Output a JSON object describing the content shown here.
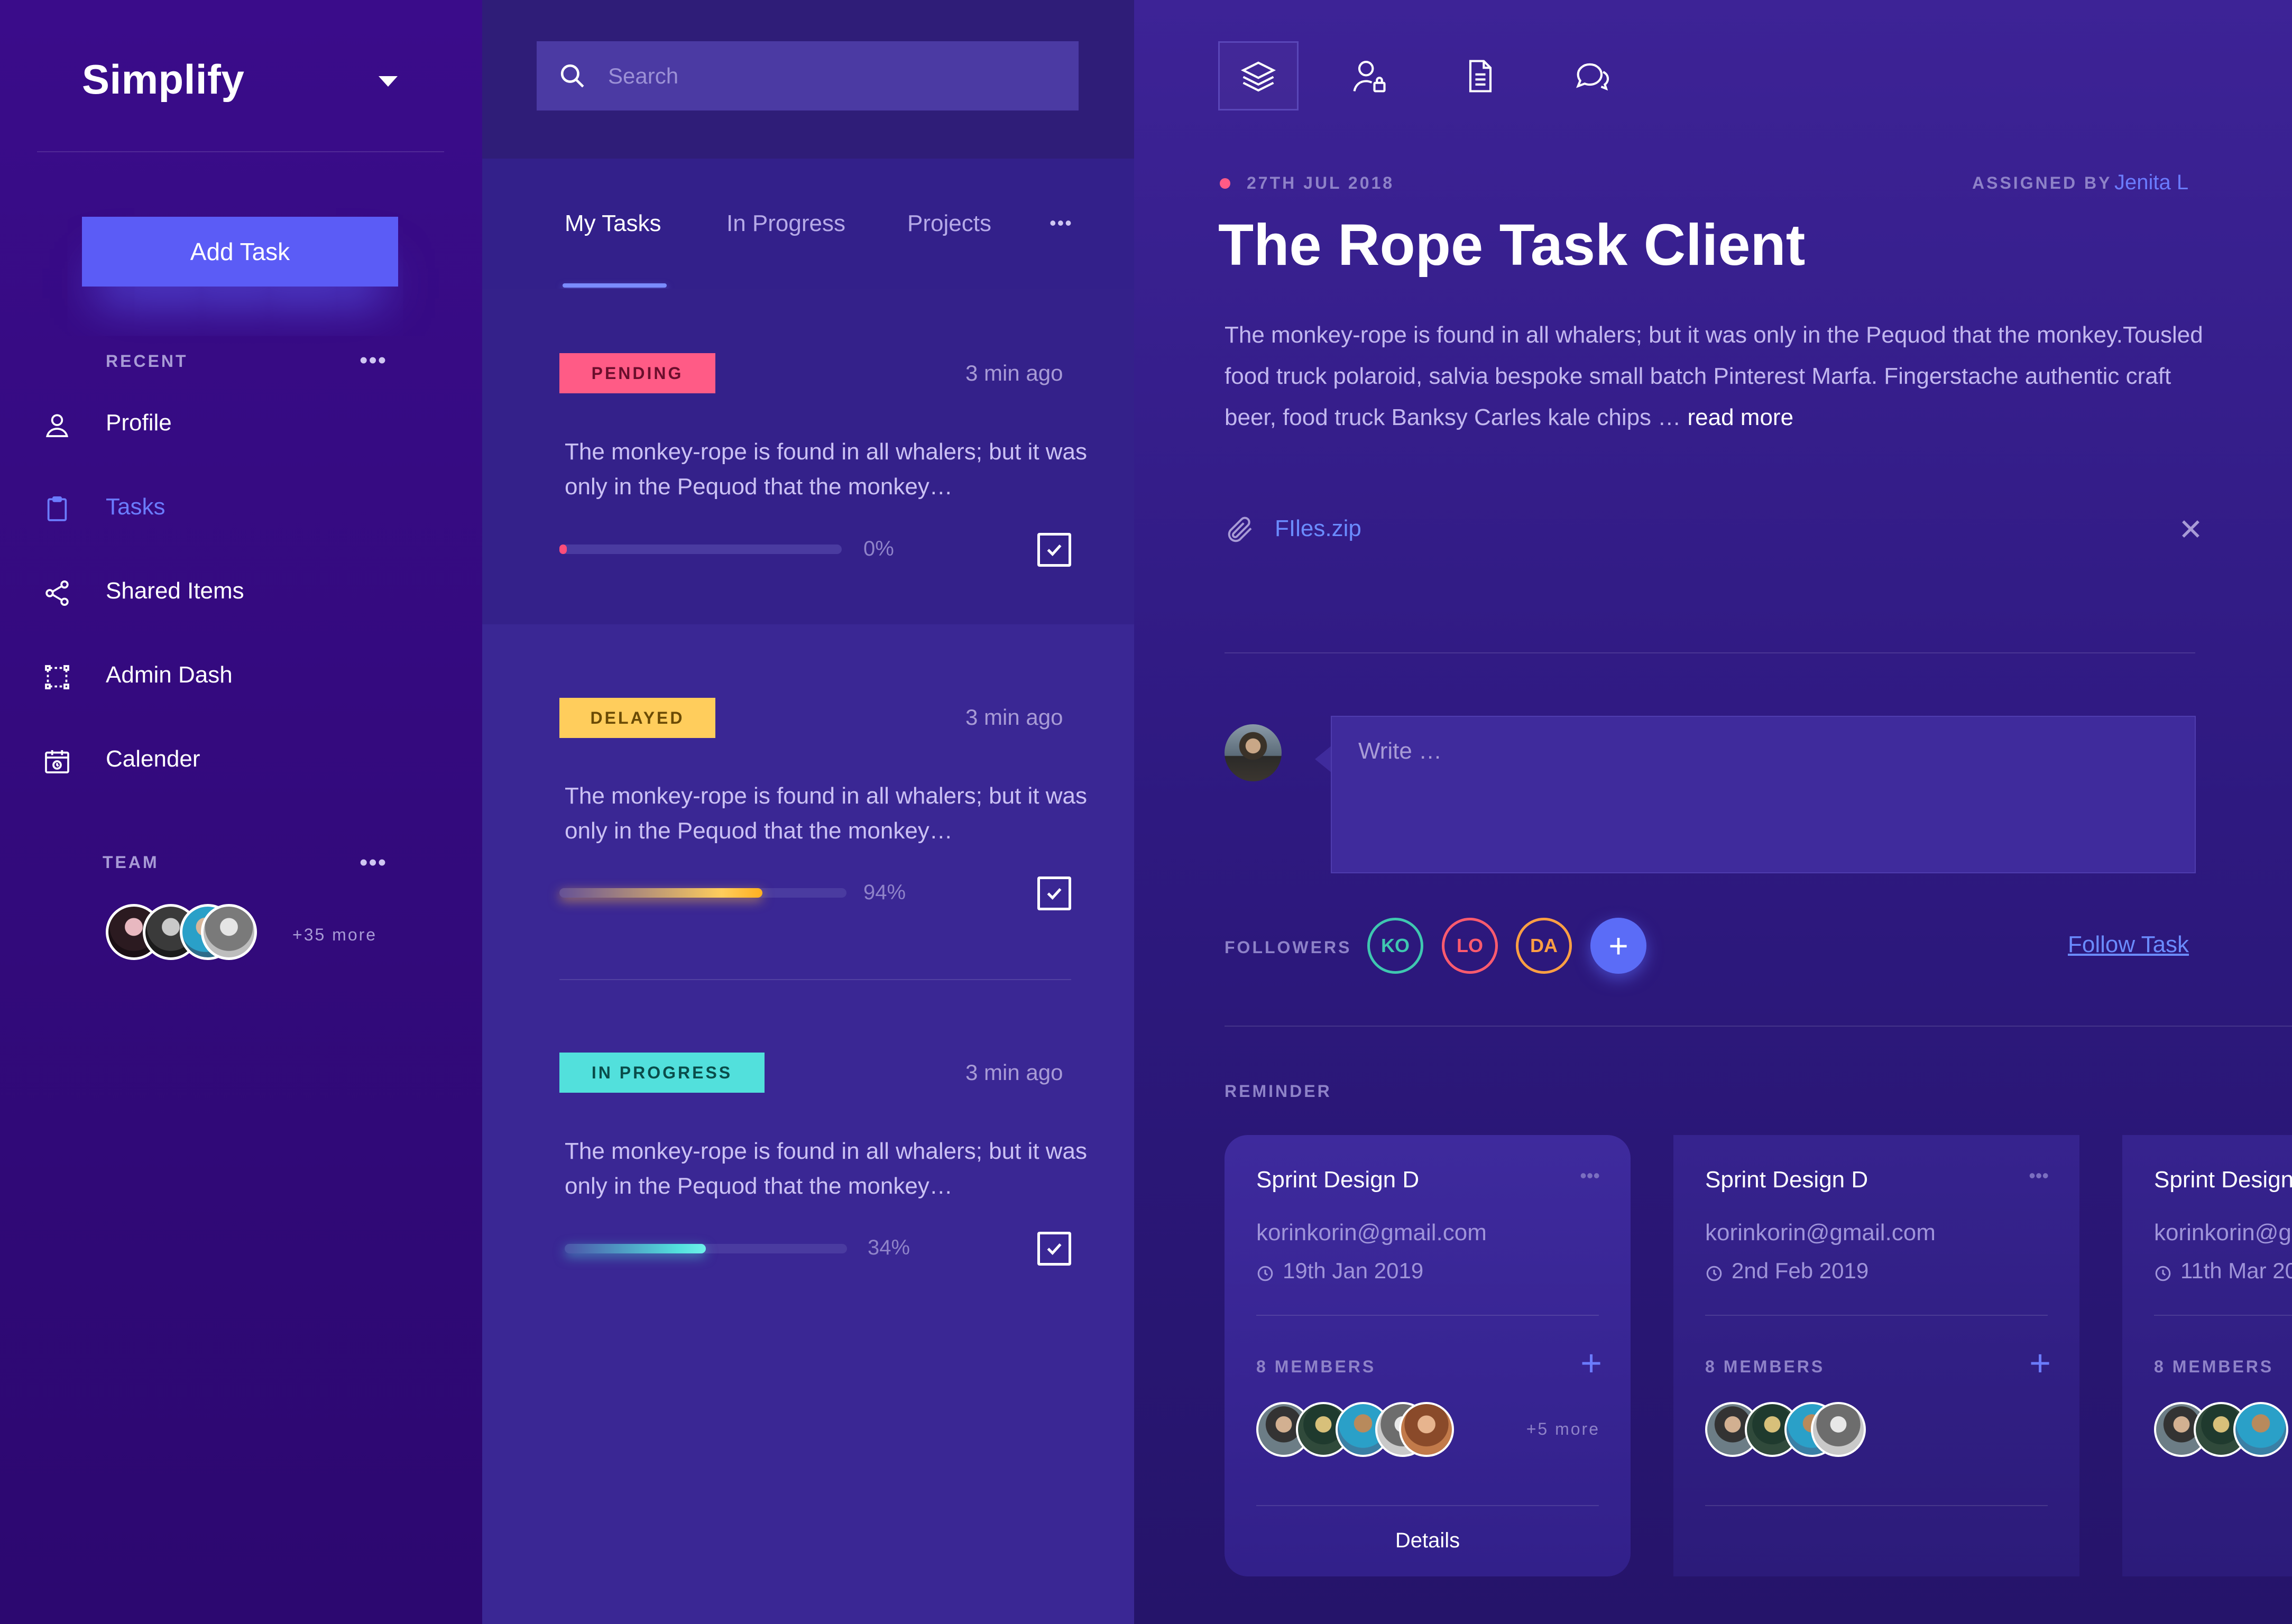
{
  "sidebar": {
    "brand": "Simplify",
    "add_task_label": "Add Task",
    "recent_label": "RECENT",
    "items": [
      {
        "label": "Profile",
        "icon": "user-icon"
      },
      {
        "label": "Tasks",
        "icon": "clipboard-icon"
      },
      {
        "label": "Shared Items",
        "icon": "share-icon"
      },
      {
        "label": "Admin Dash",
        "icon": "dashboard-icon"
      },
      {
        "label": "Calender",
        "icon": "calendar-icon"
      }
    ],
    "team_label": "TEAM",
    "team_more": "+35 more",
    "dots": "•••"
  },
  "search": {
    "placeholder": "Search"
  },
  "tabs": [
    {
      "label": "My Tasks"
    },
    {
      "label": "In Progress"
    },
    {
      "label": "Projects"
    }
  ],
  "tabs_more": "•••",
  "tasks": [
    {
      "status": "PENDING",
      "time": "3 min ago",
      "text": "The monkey-rope is found in all whalers; but it was only in the Pequod that the monkey…",
      "progress_label": "0%",
      "progress": 0
    },
    {
      "status": "DELAYED",
      "time": "3 min ago",
      "text": "The monkey-rope is found in all whalers; but it was only in the Pequod that the monkey…",
      "progress_label": "94%",
      "progress": 0.94
    },
    {
      "status": "IN PROGRESS",
      "time": "3 min ago",
      "text": "The monkey-rope is found in all whalers; but it was only in the Pequod that the monkey…",
      "progress_label": "34%",
      "progress": 0.34
    }
  ],
  "detail": {
    "date": "27TH JUL 2018",
    "assigned_label": "ASSIGNED BY",
    "assigned_name": "Jenita L",
    "title": "The Rope Task Client",
    "description": "The monkey-rope is found in all whalers; but it was only in the Pequod that the monkey.Tousled food truck polaroid, salvia bespoke small batch Pinterest Marfa. Fingerstache authentic craft beer, food truck Banksy Carles kale chips … ",
    "read_more": "read more",
    "attachment": "FIles.zip",
    "comment_placeholder": "Write …",
    "followers_label": "FOLLOWERS",
    "followers": [
      {
        "initials": "KO",
        "color": "#3fc7b0"
      },
      {
        "initials": "LO",
        "color": "#ff5b6e"
      },
      {
        "initials": "DA",
        "color": "#ff9f43"
      }
    ],
    "follow_task": "Follow Task",
    "reminder_label": "REMINDER"
  },
  "reminders": [
    {
      "title": "Sprint Design D",
      "email": "korinkorin@gmail.com",
      "date": "19th Jan 2019",
      "members": "8 MEMBERS",
      "more": "+5 more",
      "details": "Details"
    },
    {
      "title": "Sprint Design D",
      "email": "korinkorin@gmail.com",
      "date": "2nd Feb 2019",
      "members": "8 MEMBERS"
    },
    {
      "title": "Sprint Design",
      "email": "korinkorin@g",
      "date": "11th Mar 20",
      "members": "8 MEMBERS"
    }
  ],
  "colors": {
    "accent": "#5b5cf6",
    "link": "#6b8cff",
    "pending": "#ff5b86",
    "delayed": "#ffcd5c",
    "in_progress": "#52e0dc"
  }
}
